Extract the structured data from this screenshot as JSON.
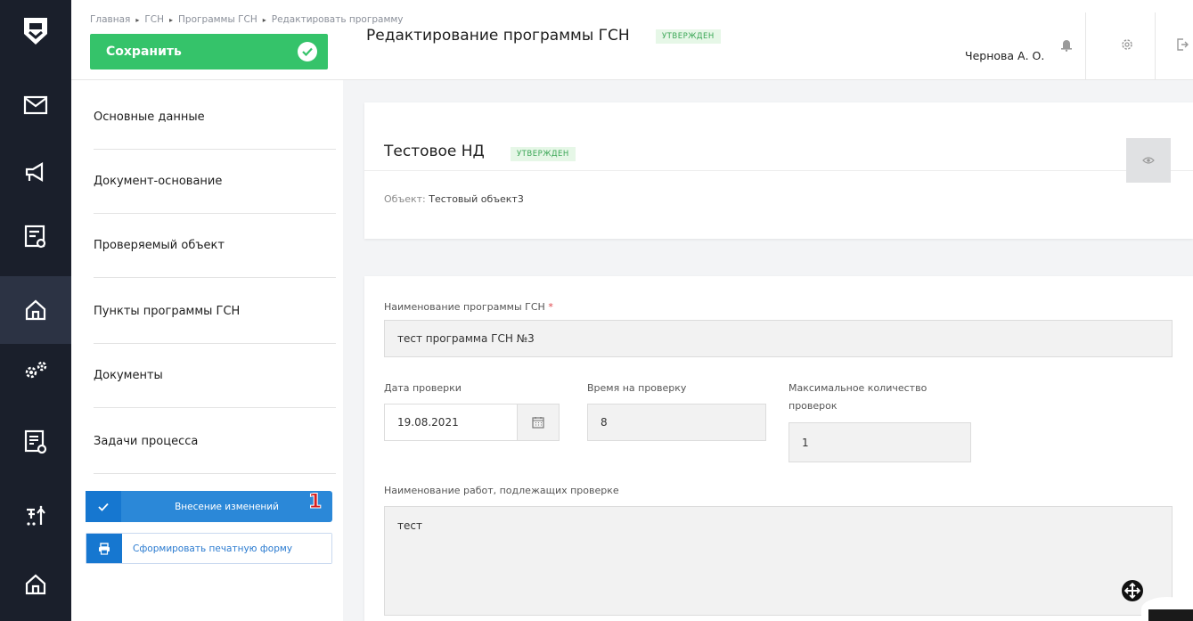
{
  "rail": {
    "items": [
      {
        "icon": "mail-icon"
      },
      {
        "icon": "megaphone-icon"
      },
      {
        "icon": "checklist-icon"
      },
      {
        "icon": "home-icon",
        "active": true
      },
      {
        "icon": "gears-icon"
      },
      {
        "icon": "report-icon"
      },
      {
        "icon": "sort-icon"
      },
      {
        "icon": "home-icon"
      }
    ]
  },
  "breadcrumb": {
    "items": [
      "Главная",
      "ГСН",
      "Программы ГСН",
      "Редактировать программу"
    ],
    "separator": "▸"
  },
  "toolbar": {
    "save_label": "Сохранить"
  },
  "page": {
    "title": "Редактирование программы ГСН",
    "status": "утвержден"
  },
  "user": {
    "name": "Чернова А. О."
  },
  "subnav": {
    "items": [
      "Основные данные",
      "Документ-основание",
      "Проверяемый объект",
      "Пункты программы ГСН",
      "Документы",
      "Задачи процесса"
    ],
    "changes_button": "Внесение изменений",
    "changes_number": "1",
    "print_button": "Сформировать печатную форму"
  },
  "nd_card": {
    "title": "Тестовое НД",
    "status": "утвержден",
    "object_label": "Объект:",
    "object_value": "Тестовый объект3"
  },
  "form": {
    "name_label": "Наименование программы ГСН",
    "name_required": "*",
    "name_value": "тест программа ГСН №3",
    "date_label": "Дата проверки",
    "date_value": "19.08.2021",
    "time_label": "Время на проверку",
    "time_value": "8",
    "max_label_line1": "Максимальное количество",
    "max_label_line2": "проверок",
    "max_value": "1",
    "works_label": "Наименование работ, подлежащих проверке",
    "works_value": "тест"
  },
  "colors": {
    "rail": "#1a1f2b",
    "save_green": "#35c36a",
    "primary_blue": "#2b88d8",
    "badge_green": "#3aa655"
  }
}
